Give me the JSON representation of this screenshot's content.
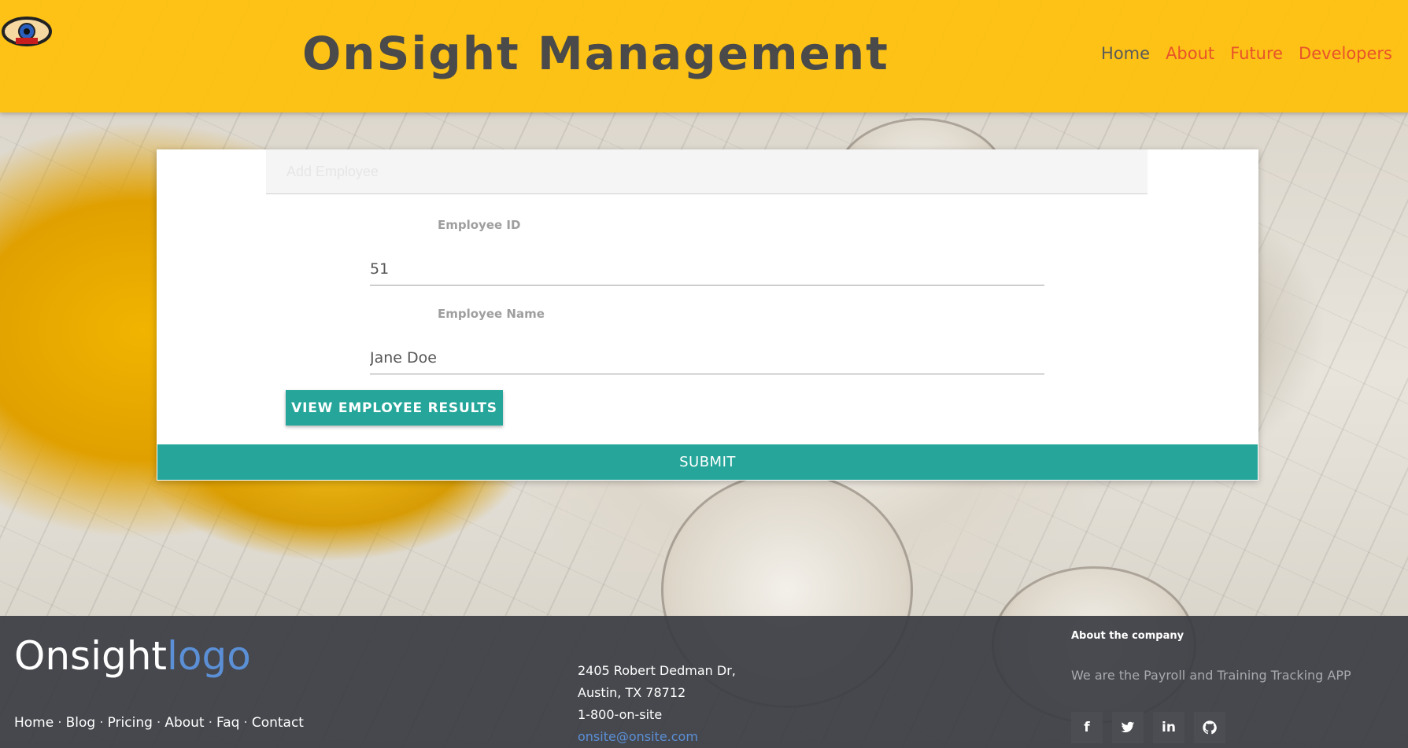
{
  "header": {
    "title": "OnSight Management",
    "nav": [
      {
        "label": "Home",
        "active": true
      },
      {
        "label": "About",
        "active": false
      },
      {
        "label": "Future",
        "active": false
      },
      {
        "label": "Developers",
        "active": false
      }
    ],
    "bar_color": "#FFC107",
    "nav_color": "#E8532A"
  },
  "form": {
    "top_field_placeholder": "Add Employee",
    "employee_id": {
      "label": "Employee ID",
      "value": "51"
    },
    "employee_name": {
      "label": "Employee Name",
      "value": "Jane Doe"
    },
    "view_button_label": "VIEW EMPLOYEE RESULTS",
    "submit_label": "SUBMIT",
    "accent_color": "#26A69A"
  },
  "footer": {
    "logo_main": "Onsight",
    "logo_accent": "logo",
    "links": [
      "Home",
      "Blog",
      "Pricing",
      "About",
      "Faq",
      "Contact"
    ],
    "address_line1": "2405 Robert Dedman Dr,",
    "address_line2": "Austin, TX 78712",
    "phone": "1-800-on-site",
    "email": "onsite@onsite.com",
    "about_heading": "About the company",
    "about_text": "We are the Payroll and Training Tracking APP",
    "social_icons": [
      "facebook-icon",
      "twitter-icon",
      "linkedin-icon",
      "github-icon"
    ]
  }
}
